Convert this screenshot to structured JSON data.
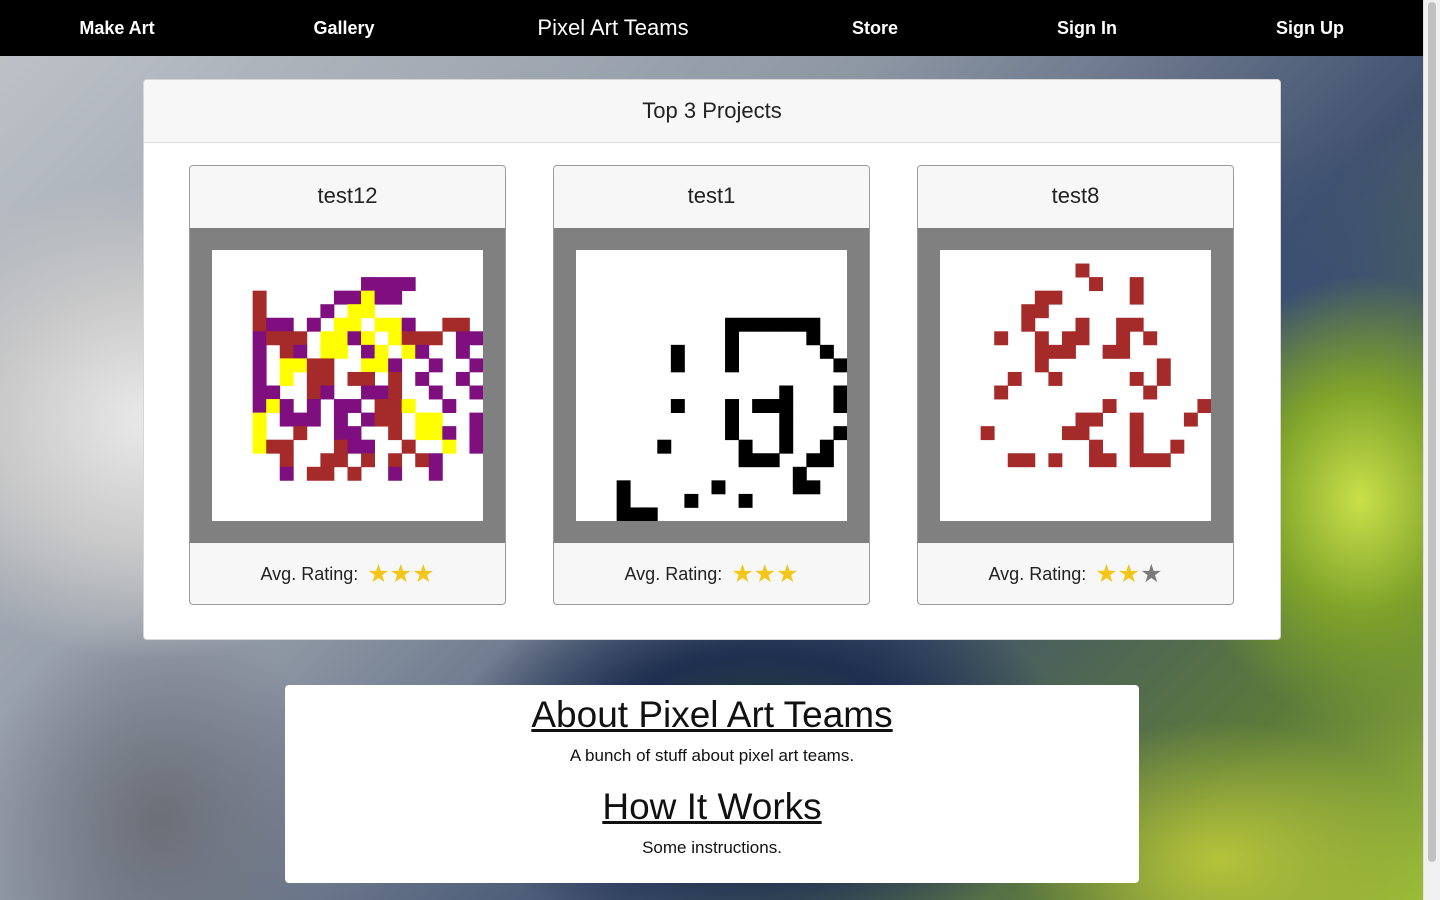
{
  "nav": {
    "make_art": "Make Art",
    "gallery": "Gallery",
    "brand": "Pixel Art Teams",
    "store": "Store",
    "sign_in": "Sign In",
    "sign_up": "Sign Up"
  },
  "top_projects": {
    "title": "Top 3 Projects",
    "projects": [
      {
        "name": "test12",
        "rating_label": "Avg. Rating:",
        "rating": 3,
        "rating_max": 3,
        "palette": [
          "#7f0f7e",
          "#ffff00",
          "#a52a2a"
        ]
      },
      {
        "name": "test1",
        "rating_label": "Avg. Rating:",
        "rating": 3,
        "rating_max": 3,
        "palette": [
          "#000000"
        ]
      },
      {
        "name": "test8",
        "rating_label": "Avg. Rating:",
        "rating": 2,
        "rating_max": 3,
        "palette": [
          "#a52a2a"
        ]
      }
    ]
  },
  "about": {
    "title": "About Pixel Art Teams",
    "text": "A bunch of stuff about pixel art teams.",
    "how_title": "How It Works",
    "how_text": "Some instructions."
  },
  "colors": {
    "navbar": "#000000",
    "star_filled": "#f5c518",
    "star_empty": "#7a7a7a",
    "frame": "#808080"
  }
}
